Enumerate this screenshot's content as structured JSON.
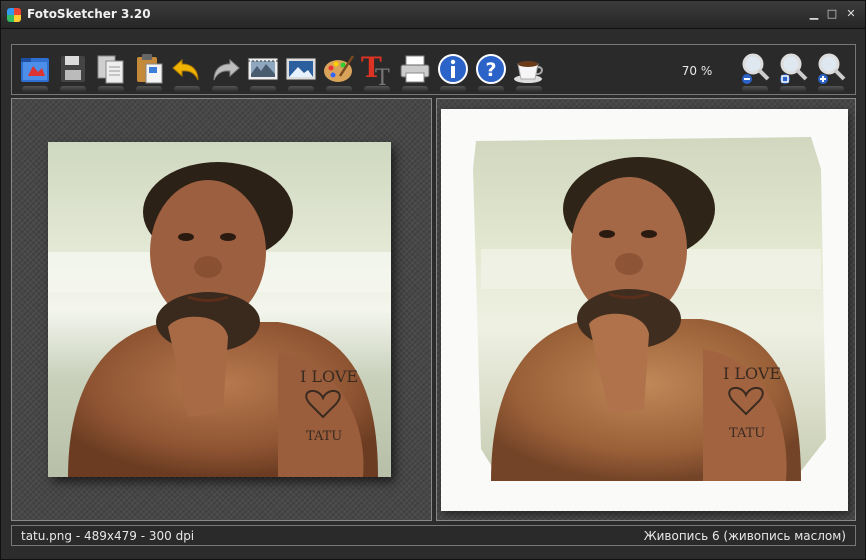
{
  "window": {
    "title": "FotoSketcher 3.20",
    "minimize_glyph": "▁",
    "maximize_glyph": "□",
    "close_glyph": "✕"
  },
  "toolbar": {
    "buttons": [
      {
        "icon": "open-folder-icon"
      },
      {
        "icon": "save-icon"
      },
      {
        "icon": "copy-icon"
      },
      {
        "icon": "paste-icon"
      },
      {
        "icon": "undo-icon"
      },
      {
        "icon": "redo-icon"
      },
      {
        "icon": "parameters-icon"
      },
      {
        "icon": "picture-icon"
      },
      {
        "icon": "palette-icon"
      },
      {
        "icon": "text-icon"
      },
      {
        "icon": "print-icon"
      },
      {
        "icon": "info-icon"
      },
      {
        "icon": "help-icon"
      },
      {
        "icon": "coffee-cup-icon"
      },
      {
        "icon": "zoom-out-icon"
      },
      {
        "icon": "zoom-fit-icon"
      },
      {
        "icon": "zoom-in-icon"
      }
    ],
    "zoom_level": "70 %"
  },
  "source_image": {
    "tattoo_line1": "I LOVE",
    "tattoo_line2": "TATU"
  },
  "result_image": {
    "tattoo_line1": "I LOVE",
    "tattoo_line2": "TATU"
  },
  "status": {
    "file_info": "tatu.png - 489x479 - 300 dpi",
    "effect": "Живопись 6 (живопись маслом)"
  },
  "colors": {
    "window_bg": "#2c2c2c",
    "pane_bg": "#484848",
    "accent_blue": "#2f6fd0"
  }
}
